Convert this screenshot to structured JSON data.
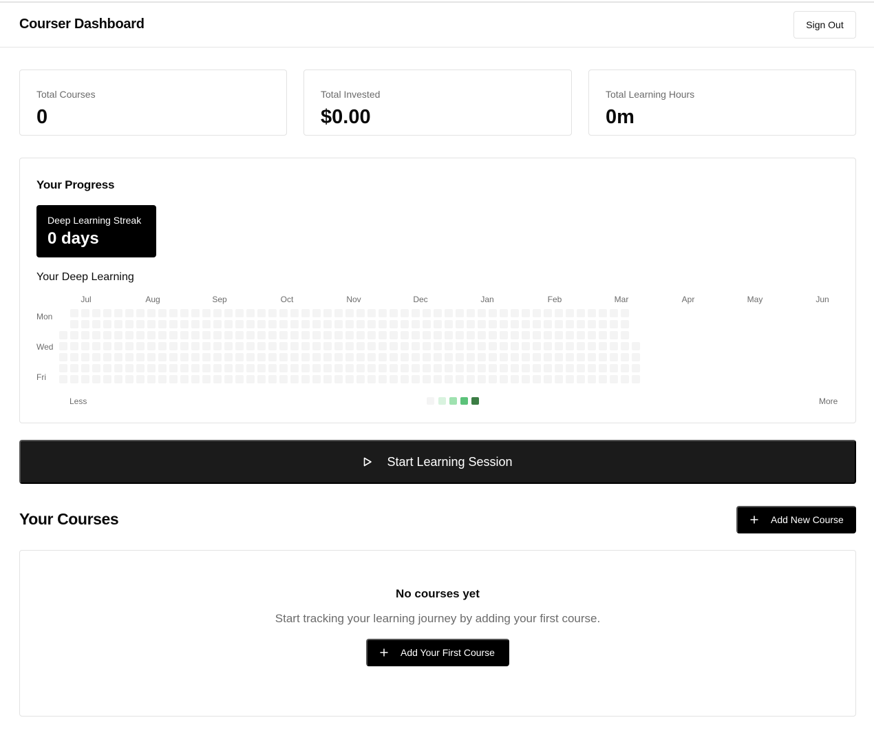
{
  "header": {
    "title": "Courser Dashboard",
    "sign_out_label": "Sign Out"
  },
  "stats": [
    {
      "label": "Total Courses",
      "value": "0"
    },
    {
      "label": "Total Invested",
      "value": "$0.00"
    },
    {
      "label": "Total Learning Hours",
      "value": "0m"
    }
  ],
  "progress": {
    "title": "Your Progress",
    "streak_label": "Deep Learning Streak",
    "streak_value": "0 days",
    "heatmap_title": "Your Deep Learning",
    "months": [
      "Jul",
      "Aug",
      "Sep",
      "Oct",
      "Nov",
      "Dec",
      "Jan",
      "Feb",
      "Mar",
      "Apr",
      "May",
      "Jun"
    ],
    "weekday_labels": [
      "Mon",
      "Wed",
      "Fri"
    ],
    "legend_less": "Less",
    "legend_more": "More",
    "legend_colors": [
      "#f4f4f4",
      "#d9f3df",
      "#9fe2b0",
      "#5cc27a",
      "#3c7d45"
    ],
    "empty_cell_color": "#f4f4f4"
  },
  "start_session_label": "Start Learning Session",
  "courses": {
    "title": "Your Courses",
    "add_label": "Add New Course",
    "empty_title": "No courses yet",
    "empty_desc": "Start tracking your learning journey by adding your first course.",
    "first_course_label": "Add Your First Course"
  }
}
